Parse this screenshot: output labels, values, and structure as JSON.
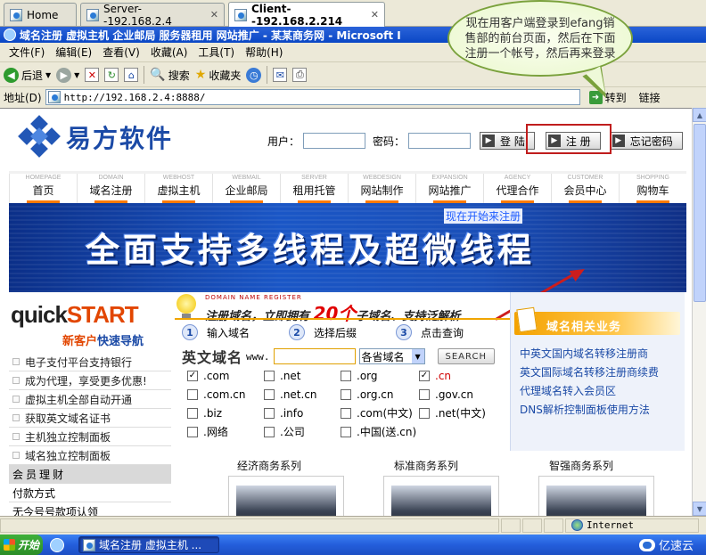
{
  "tabs": [
    {
      "label": "Home"
    },
    {
      "label": "Server--192.168.2.4"
    },
    {
      "label": "Client--192.168.2.214"
    }
  ],
  "window_title": "域名注册 虚拟主机 企业邮局 服务器租用 网站推广 - 某某商务网 - Microsoft I",
  "menu": [
    "文件(F)",
    "编辑(E)",
    "查看(V)",
    "收藏(A)",
    "工具(T)",
    "帮助(H)"
  ],
  "toolbar": {
    "back": "后退",
    "search": "搜索",
    "favorites": "收藏夹"
  },
  "address": {
    "label": "地址(D)",
    "url": "http://192.168.2.4:8888/",
    "go": "转到",
    "links": "链接"
  },
  "callout": "现在用客户端登录到efang销售部的前台页面，然后在下面注册一个帐号，然后再来登录",
  "site": {
    "logo": "易方软件",
    "login": {
      "user_label": "用户：",
      "pass_label": "密码：",
      "login_btn": "登 陆",
      "register_btn": "注 册",
      "forgot_btn": "忘记密码"
    },
    "nav": [
      {
        "en": "HOMEPAGE",
        "cn": "首页"
      },
      {
        "en": "DOMAIN",
        "cn": "域名注册"
      },
      {
        "en": "WEBHOST",
        "cn": "虚拟主机"
      },
      {
        "en": "WEBMAIL",
        "cn": "企业邮局"
      },
      {
        "en": "SERVER",
        "cn": "租用托管"
      },
      {
        "en": "WEBDESIGN",
        "cn": "网站制作"
      },
      {
        "en": "EXPANSION",
        "cn": "网站推广"
      },
      {
        "en": "AGENCY",
        "cn": "代理合作"
      },
      {
        "en": "CUSTOMER",
        "cn": "会员中心"
      },
      {
        "en": "SHOPPING",
        "cn": "购物车"
      }
    ],
    "banner_text": "全面支持多线程及超微线程",
    "banner_note": "现在开始来注册",
    "quickstart": {
      "q1": "quick",
      "q2": "START",
      "sub1": "新客户",
      "sub2": "快速导航"
    },
    "left_items": [
      "电子支付平台支持银行",
      "成为代理，享受更多优惠!",
      "虚拟主机全部自动开通",
      "获取英文域名证书",
      "主机独立控制面板",
      "域名独立控制面板"
    ],
    "member_head": "会员理财",
    "member_items": [
      "付款方式",
      "无今号号款项认领"
    ],
    "domain": {
      "en": "DOMAIN NAME REGISTER",
      "title_a": "注册域名，立即拥有",
      "title_num": "20个",
      "title_b": "子域名、支持泛解析",
      "steps": [
        {
          "n": "1",
          "t": "输入域名"
        },
        {
          "n": "2",
          "t": "选择后缀"
        },
        {
          "n": "3",
          "t": "点击查询"
        }
      ],
      "label": "英文域名",
      "www": "www.",
      "select": "各省域名",
      "search": "SEARCH",
      "tlds": [
        {
          "t": ".com",
          "checked": true
        },
        {
          "t": ".net",
          "checked": false
        },
        {
          "t": ".org",
          "checked": false
        },
        {
          "t": ".cn",
          "checked": true,
          "red": true
        },
        {
          "t": ".com.cn",
          "checked": false
        },
        {
          "t": ".net.cn",
          "checked": false
        },
        {
          "t": ".org.cn",
          "checked": false
        },
        {
          "t": ".gov.cn",
          "checked": false
        },
        {
          "t": ".biz",
          "checked": false
        },
        {
          "t": ".info",
          "checked": false
        },
        {
          "t": ".com(中文)",
          "checked": false
        },
        {
          "t": ".net(中文)",
          "checked": false
        },
        {
          "t": ".网络",
          "checked": false
        },
        {
          "t": ".公司",
          "checked": false
        },
        {
          "t": ".中国(送.cn)",
          "checked": false
        }
      ]
    },
    "right_box": {
      "title": "域名相关业务",
      "links": [
        "中英文国内域名转移注册商",
        "英文国际域名转移注册商续费",
        "代理域名转入会员区",
        "DNS解析控制面板使用方法"
      ]
    },
    "series": [
      "经济商务系列",
      "标准商务系列",
      "智强商务系列"
    ]
  },
  "status": {
    "zone": "Internet"
  },
  "taskbar": {
    "start": "开始",
    "task": "域名注册 虚拟主机 ...",
    "watermark": "亿速云"
  }
}
